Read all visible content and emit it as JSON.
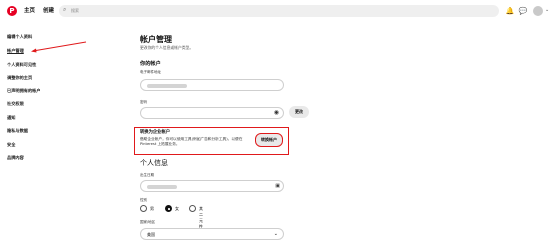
{
  "topbar": {
    "logo_glyph": "P",
    "home": "主页",
    "create": "创建",
    "search_placeholder": "搜索",
    "icons": [
      "bell-icon",
      "chat-icon",
      "avatar",
      "chevron-down-icon"
    ]
  },
  "sidebar": {
    "items": [
      "编辑个人资料",
      "帐户管理",
      "个人资料可见性",
      "调整你的主页",
      "已声明拥有的帐户",
      "社交权限",
      "通知",
      "隐私与数据",
      "安全",
      "品牌内容"
    ]
  },
  "main": {
    "title": "帐户管理",
    "subtitle": "更改你的个人信息或帐户类型。",
    "your_account": "你的帐户",
    "email_label": "电子邮件地址",
    "password_label": "密码",
    "change_button": "更改",
    "business": {
      "title": "转换为企业帐户",
      "desc": "借助企业帐户，你可以使用工具(例如广告和分析工具)，以便在 Pinterest 上拓展业务。",
      "button": "转换帐户"
    },
    "personal_info": "个人信息",
    "birthdate_label": "出生日期",
    "gender_label": "性别",
    "gender_options": [
      "男",
      "女",
      "其二元性别"
    ],
    "gender_selected": 1,
    "country_label": "国家/地区",
    "country_value": "美国"
  },
  "colors": {
    "brand": "#e60023",
    "annotation": "#e0191b"
  }
}
